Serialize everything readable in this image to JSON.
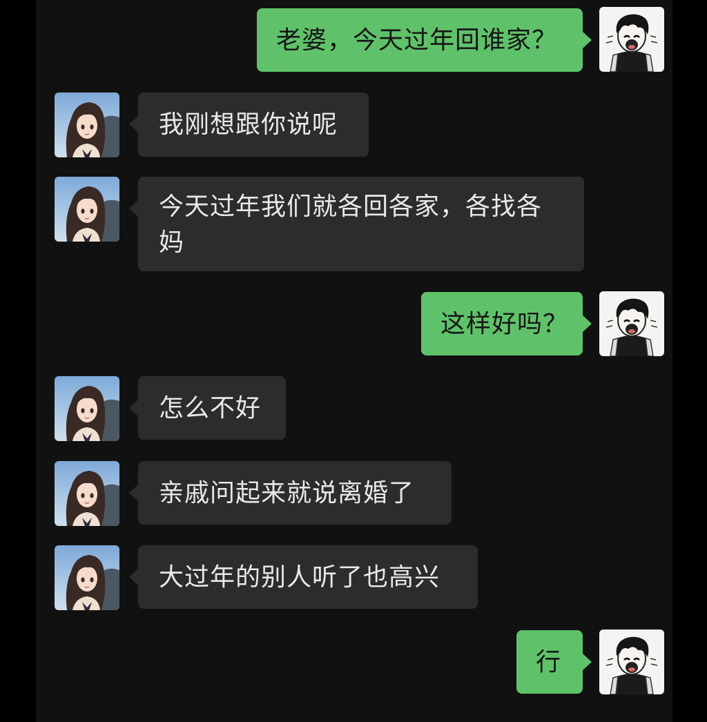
{
  "conversation": {
    "messages": [
      {
        "sender": "me",
        "avatar_icon": "cartoon-boy-avatar-icon",
        "text": "老婆，今天过年回谁家？"
      },
      {
        "sender": "wife",
        "avatar_icon": "anime-girl-avatar-icon",
        "text": "我刚想跟你说呢"
      },
      {
        "sender": "wife",
        "avatar_icon": "anime-girl-avatar-icon",
        "text": "今天过年我们就各回各家，各找各妈"
      },
      {
        "sender": "me",
        "avatar_icon": "cartoon-boy-avatar-icon",
        "text": "这样好吗？"
      },
      {
        "sender": "wife",
        "avatar_icon": "anime-girl-avatar-icon",
        "text": "怎么不好"
      },
      {
        "sender": "wife",
        "avatar_icon": "anime-girl-avatar-icon",
        "text": "亲戚问起来就说离婚了"
      },
      {
        "sender": "wife",
        "avatar_icon": "anime-girl-avatar-icon",
        "text": "大过年的别人听了也高兴"
      },
      {
        "sender": "me",
        "avatar_icon": "cartoon-boy-avatar-icon",
        "text": "行"
      }
    ]
  },
  "colors": {
    "background": "#111111",
    "incoming_bubble": "#2c2c2c",
    "outgoing_bubble": "#5fc26a",
    "incoming_text": "#e9e9e9",
    "outgoing_text": "#161616"
  }
}
